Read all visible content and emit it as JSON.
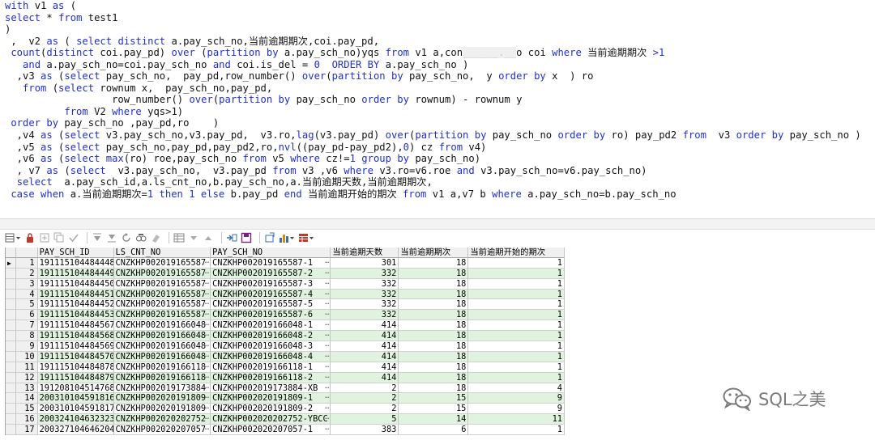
{
  "editor": {
    "lines": [
      [
        [
          "kw",
          "with "
        ],
        [
          "tx",
          "v1 "
        ],
        [
          "kw",
          "as "
        ],
        [
          "tx",
          "("
        ]
      ],
      [
        [
          "kw",
          "select "
        ],
        [
          "tx",
          "* "
        ],
        [
          "kw",
          "from "
        ],
        [
          "tx",
          "test1"
        ]
      ],
      [
        [
          "tx",
          ")"
        ]
      ],
      [
        [
          "tx",
          " ,  v2 "
        ],
        [
          "kw",
          "as "
        ],
        [
          "tx",
          "( "
        ],
        [
          "kw",
          "select distinct "
        ],
        [
          "tx",
          "a.pay_sch_no,当前逾期期次,coi.pay_pd,"
        ]
      ],
      [
        [
          "tx",
          " "
        ],
        [
          "kw",
          "count"
        ],
        [
          "tx",
          "("
        ],
        [
          "kw",
          "distinct "
        ],
        [
          "tx",
          "coi.pay_pd) "
        ],
        [
          "kw",
          "over "
        ],
        [
          "tx",
          "("
        ],
        [
          "kw",
          "partition by "
        ],
        [
          "tx",
          "a.pay_sch_no)yqs "
        ],
        [
          "kw",
          "from "
        ],
        [
          "tx",
          "v1 a,con"
        ],
        [
          "blur",
          "______.__"
        ],
        [
          "tx",
          "o coi "
        ],
        [
          "kw",
          "where "
        ],
        [
          "tx",
          "当前逾期期次 "
        ],
        [
          "kw",
          ">1"
        ]
      ],
      [
        [
          "tx",
          "   "
        ],
        [
          "kw",
          "and "
        ],
        [
          "tx",
          "a.pay_sch_no=coi.pay_sch_no "
        ],
        [
          "kw",
          "and "
        ],
        [
          "tx",
          "coi.is_del = "
        ],
        [
          "num",
          "0  "
        ],
        [
          "kw",
          "ORDER BY "
        ],
        [
          "tx",
          "a.pay_sch_no )"
        ]
      ],
      [
        [
          "tx",
          "  ,v3 "
        ],
        [
          "kw",
          "as "
        ],
        [
          "tx",
          "("
        ],
        [
          "kw",
          "select "
        ],
        [
          "tx",
          "pay_sch_no,  pay_pd,row_number() "
        ],
        [
          "kw",
          "over"
        ],
        [
          "tx",
          "("
        ],
        [
          "kw",
          "partition by "
        ],
        [
          "tx",
          "pay_sch_no,  y "
        ],
        [
          "kw",
          "order by "
        ],
        [
          "tx",
          "x  ) ro"
        ]
      ],
      [
        [
          "tx",
          "   "
        ],
        [
          "kw",
          "from "
        ],
        [
          "tx",
          "("
        ],
        [
          "kw",
          "select "
        ],
        [
          "tx",
          "rownum x,  pay_sch_no,pay_pd,"
        ]
      ],
      [
        [
          "tx",
          "                  row_number() "
        ],
        [
          "kw",
          "over"
        ],
        [
          "tx",
          "("
        ],
        [
          "kw",
          "partition by "
        ],
        [
          "tx",
          "pay_sch_no "
        ],
        [
          "kw",
          "order by "
        ],
        [
          "tx",
          "rownum) - rownum y"
        ]
      ],
      [
        [
          "tx",
          "          "
        ],
        [
          "kw",
          "from "
        ],
        [
          "tx",
          "V2 "
        ],
        [
          "kw",
          "where "
        ],
        [
          "tx",
          "yqs>1)"
        ]
      ],
      [
        [
          "tx",
          " "
        ],
        [
          "kw",
          "order by "
        ],
        [
          "tx",
          "pay_sch_no ,pay_pd,ro    )"
        ]
      ],
      [
        [
          "tx",
          "  ,v4 "
        ],
        [
          "kw",
          "as "
        ],
        [
          "tx",
          "("
        ],
        [
          "kw",
          "select "
        ],
        [
          "tx",
          "v3.pay_sch_no,v3.pay_pd,  v3.ro,"
        ],
        [
          "kw",
          "lag"
        ],
        [
          "tx",
          "(v3.pay_pd) "
        ],
        [
          "kw",
          "over"
        ],
        [
          "tx",
          "("
        ],
        [
          "kw",
          "partition by "
        ],
        [
          "tx",
          "pay_sch_no "
        ],
        [
          "kw",
          "order by "
        ],
        [
          "tx",
          "ro) pay_pd2 "
        ],
        [
          "kw",
          "from  "
        ],
        [
          "tx",
          "v3 "
        ],
        [
          "kw",
          "order by "
        ],
        [
          "tx",
          "pay_sch_no )"
        ]
      ],
      [
        [
          "tx",
          "  ,v5 "
        ],
        [
          "kw",
          "as "
        ],
        [
          "tx",
          "("
        ],
        [
          "kw",
          "select "
        ],
        [
          "tx",
          "pay_sch_no,pay_pd,pay_pd2,ro,"
        ],
        [
          "kw",
          "nvl"
        ],
        [
          "tx",
          "((pay_pd-pay_pd2),"
        ],
        [
          "num",
          "0"
        ],
        [
          "tx",
          ") cz "
        ],
        [
          "kw",
          "from "
        ],
        [
          "tx",
          "v4)"
        ]
      ],
      [
        [
          "tx",
          "  ,v6 "
        ],
        [
          "kw",
          "as "
        ],
        [
          "tx",
          "("
        ],
        [
          "kw",
          "select max"
        ],
        [
          "tx",
          "(ro) roe,pay_sch_no "
        ],
        [
          "kw",
          "from "
        ],
        [
          "tx",
          "v5 "
        ],
        [
          "kw",
          "where "
        ],
        [
          "tx",
          "cz!="
        ],
        [
          "num",
          "1 "
        ],
        [
          "kw",
          "group by "
        ],
        [
          "tx",
          "pay_sch_no)"
        ]
      ],
      [
        [
          "tx",
          "  , v7 "
        ],
        [
          "kw",
          "as "
        ],
        [
          "tx",
          "("
        ],
        [
          "kw",
          "select  "
        ],
        [
          "tx",
          "v3.pay_sch_no,  v3.pay_pd "
        ],
        [
          "kw",
          "from "
        ],
        [
          "tx",
          "v3 ,v6 "
        ],
        [
          "kw",
          "where "
        ],
        [
          "tx",
          "v3.ro=v6.roe "
        ],
        [
          "kw",
          "and "
        ],
        [
          "tx",
          "v3.pay_sch_no=v6.pay_sch_no)"
        ]
      ],
      [
        [
          "tx",
          "  "
        ],
        [
          "kw",
          "select  "
        ],
        [
          "tx",
          "a.pay_sch_id,a.ls_cnt_no,b.pay_sch_no,a.当前逾期天数,当前逾期期次,"
        ]
      ],
      [
        [
          "tx",
          " "
        ],
        [
          "kw",
          "case when "
        ],
        [
          "tx",
          "a.当前逾期期次="
        ],
        [
          "num",
          "1 "
        ],
        [
          "kw",
          "then "
        ],
        [
          "num",
          "1 "
        ],
        [
          "kw",
          "else "
        ],
        [
          "tx",
          "b.pay_pd "
        ],
        [
          "kw",
          "end "
        ],
        [
          "tx",
          "当前逾期开始的期次 "
        ],
        [
          "kw",
          "from "
        ],
        [
          "tx",
          "v1 a,v7 b "
        ],
        [
          "kw",
          "where "
        ],
        [
          "tx",
          "a.pay_sch_no=b.pay_sch_no"
        ]
      ]
    ]
  },
  "grid": {
    "headers": [
      "PAY_SCH_ID",
      "LS_CNT_NO",
      "PAY_SCH_NO",
      "当前逾期天数",
      "当前逾期期次",
      "当前逾期开始的期次"
    ],
    "rows": [
      [
        "1",
        "191115104484448",
        "CNZKHP002019165587",
        "CNZKHP002019165587-1",
        "301",
        "18",
        "1"
      ],
      [
        "2",
        "191115104484449",
        "CNZKHP002019165587",
        "CNZKHP002019165587-2",
        "332",
        "18",
        "1"
      ],
      [
        "3",
        "191115104484450",
        "CNZKHP002019165587",
        "CNZKHP002019165587-3",
        "332",
        "18",
        "1"
      ],
      [
        "4",
        "191115104484451",
        "CNZKHP002019165587",
        "CNZKHP002019165587-4",
        "332",
        "18",
        "1"
      ],
      [
        "5",
        "191115104484452",
        "CNZKHP002019165587",
        "CNZKHP002019165587-5",
        "332",
        "18",
        "1"
      ],
      [
        "6",
        "191115104484453",
        "CNZKHP002019165587",
        "CNZKHP002019165587-6",
        "332",
        "18",
        "1"
      ],
      [
        "7",
        "191115104484567",
        "CNZKHP002019166048",
        "CNZKHP002019166048-1",
        "414",
        "18",
        "1"
      ],
      [
        "8",
        "191115104484568",
        "CNZKHP002019166048",
        "CNZKHP002019166048-2",
        "414",
        "18",
        "1"
      ],
      [
        "9",
        "191115104484569",
        "CNZKHP002019166048",
        "CNZKHP002019166048-3",
        "414",
        "18",
        "1"
      ],
      [
        "10",
        "191115104484570",
        "CNZKHP002019166048",
        "CNZKHP002019166048-4",
        "414",
        "18",
        "1"
      ],
      [
        "11",
        "191115104484878",
        "CNZKHP002019166118",
        "CNZKHP002019166118-1",
        "414",
        "18",
        "1"
      ],
      [
        "12",
        "191115104484879",
        "CNZKHP002019166118",
        "CNZKHP002019166118-2",
        "414",
        "18",
        "1"
      ],
      [
        "13",
        "191208104514768",
        "CNZKHP002019173884",
        "CNZKHP002019173884-XB",
        "2",
        "18",
        "4"
      ],
      [
        "14",
        "200310104591816",
        "CNZKHP002020191809",
        "CNZKHP002020191809-1",
        "2",
        "15",
        "9"
      ],
      [
        "15",
        "200310104591817",
        "CNZKHP002020191809",
        "CNZKHP002020191809-2",
        "2",
        "15",
        "9"
      ],
      [
        "16",
        "200324104632323",
        "CNZKHP002020202752",
        "CNZKHP002020202752-YBCC",
        "5",
        "14",
        "11"
      ],
      [
        "17",
        "200327104646204",
        "CNZKHP002020207057",
        "CNZKHP002020207057-1",
        "383",
        "6",
        "1"
      ]
    ],
    "current_row": 0,
    "cell_more": "…",
    "current_marker": "▶"
  },
  "watermark": {
    "text": "SQL之美",
    "icon": "wechat-icon"
  },
  "toolbar": {
    "icons": [
      "grid-menu-icon",
      "lock-icon",
      "new-record-icon",
      "copy-icon",
      "check-icon",
      "separator",
      "filter-down-icon",
      "filter-clear-icon",
      "refresh-icon",
      "find-icon",
      "clear-icon",
      "separator",
      "grid-view-icon",
      "arrow-down-icon",
      "arrow-up-icon",
      "separator",
      "link-icon",
      "save-icon",
      "separator",
      "export-icon",
      "chart-icon",
      "table-icon"
    ]
  }
}
